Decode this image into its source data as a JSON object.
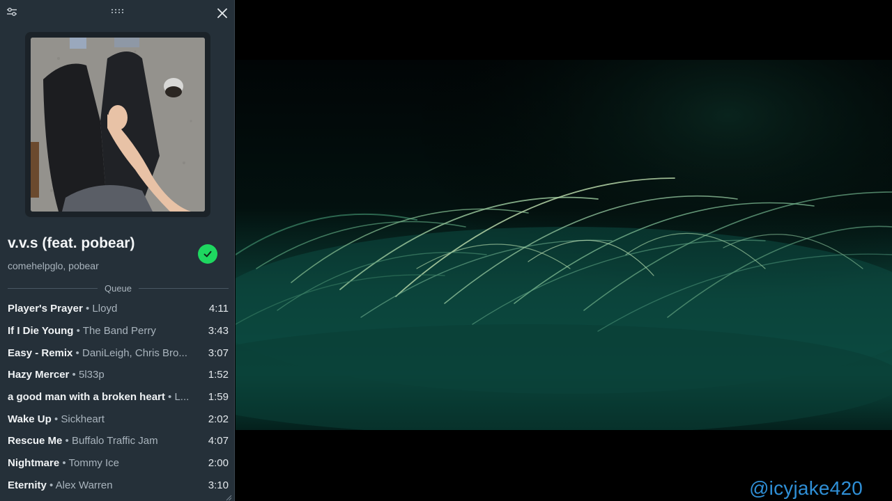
{
  "player": {
    "now_playing": {
      "title": "v.v.s (feat. pobear)",
      "artists": "comehelpglo, pobear"
    },
    "queue_label": "Queue",
    "queue": [
      {
        "title": "Player's Prayer",
        "separator": " • ",
        "artist": "Lloyd",
        "duration": "4:11"
      },
      {
        "title": "If I Die Young",
        "separator": " • ",
        "artist": "The Band Perry",
        "duration": "3:43"
      },
      {
        "title": "Easy - Remix",
        "separator": " • ",
        "artist": "DaniLeigh, Chris Bro...",
        "duration": "3:07"
      },
      {
        "title": "Hazy Mercer",
        "separator": " • ",
        "artist": "5l33p",
        "duration": "1:52"
      },
      {
        "title": "a good man with a broken heart",
        "separator": " • ",
        "artist": "L...",
        "duration": "1:59"
      },
      {
        "title": "Wake Up",
        "separator": " • ",
        "artist": "Sickheart",
        "duration": "2:02"
      },
      {
        "title": "Rescue Me",
        "separator": " • ",
        "artist": "Buffalo Traffic Jam",
        "duration": "4:07"
      },
      {
        "title": "Nightmare",
        "separator": " • ",
        "artist": "Tommy Ice",
        "duration": "2:00"
      },
      {
        "title": "Eternity",
        "separator": " • ",
        "artist": "Alex Warren",
        "duration": "3:10"
      }
    ],
    "icons": {
      "settings": "sliders-icon",
      "drag": "drag-handle-icon",
      "close": "close-icon",
      "saved": "check-circle-icon"
    },
    "colors": {
      "panel_bg": "#253039",
      "saved_green": "#1ed760"
    }
  },
  "watermark": {
    "text": "@icyjake420",
    "color": "#2f8fd6"
  }
}
